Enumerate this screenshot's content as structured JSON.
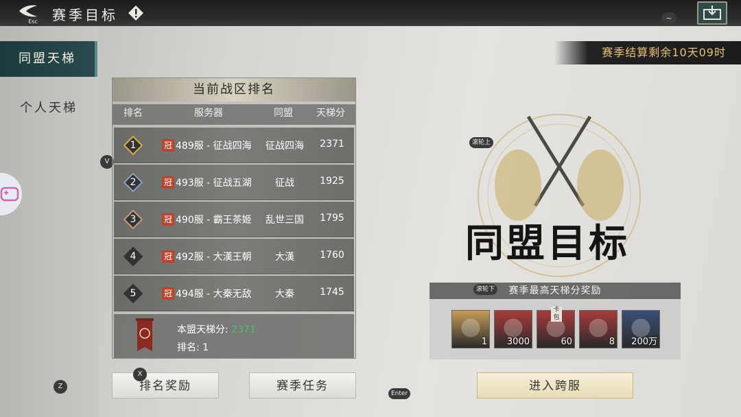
{
  "header": {
    "title": "赛季目标",
    "esc_tag": "Esc",
    "tilde_tag": "~"
  },
  "nav": {
    "items": [
      {
        "label": "同盟天梯",
        "active": true
      },
      {
        "label": "个人天梯",
        "active": false
      }
    ]
  },
  "tags": {
    "v": "V",
    "z": "Z",
    "x": "X",
    "enter": "Enter",
    "scroll_up": "滚轮上",
    "scroll_down": "滚轮下"
  },
  "ranking": {
    "title": "当前战区排名",
    "columns": [
      "排名",
      "服务器",
      "同盟",
      "天梯分"
    ],
    "rows": [
      {
        "rank": "1",
        "crown": "冠",
        "server": "489服 - 征战四海",
        "alliance": "征战四海",
        "score": "2371",
        "badge_color": "#d4b04c"
      },
      {
        "rank": "2",
        "crown": "冠",
        "server": "493服 - 征战五湖",
        "alliance": "征战",
        "score": "1925",
        "badge_color": "#8aa0c8"
      },
      {
        "rank": "3",
        "crown": "冠",
        "server": "490服 - 霸王茶姬",
        "alliance": "乱世三国",
        "score": "1795",
        "badge_color": "#c89a7a"
      },
      {
        "rank": "4",
        "crown": "冠",
        "server": "492服 - 大漢王朝",
        "alliance": "大漢",
        "score": "1760",
        "badge_color": "#333333"
      },
      {
        "rank": "5",
        "crown": "冠",
        "server": "494服 - 大秦无敌",
        "alliance": "大秦",
        "score": "1745",
        "badge_color": "#333333"
      }
    ],
    "my_score_label": "本盟天梯分:",
    "my_score_value": "2371",
    "my_rank": "排名: 1"
  },
  "buttons": {
    "rank_reward": "排名奖励",
    "season_task": "赛季任务",
    "enter_cross": "进入跨服"
  },
  "art": {
    "season_timer": "赛季结算剩余10天09时",
    "title": "同盟目标",
    "reward_title": "赛季最高天梯分奖励"
  },
  "rewards": [
    {
      "count": "1",
      "icon": "crossbow-icon",
      "bg": "#c79c58"
    },
    {
      "count": "3000",
      "icon": "jade-dragon-icon",
      "bg": "#a83a3a"
    },
    {
      "count": "60",
      "icon": "card-pack-icon",
      "bg": "#a83a3a",
      "tag": "卡包"
    },
    {
      "count": "8",
      "icon": "jade-item-icon",
      "bg": "#a83a3a"
    },
    {
      "count": "200万",
      "icon": "copper-coin-icon",
      "bg": "#3a4e78"
    }
  ]
}
